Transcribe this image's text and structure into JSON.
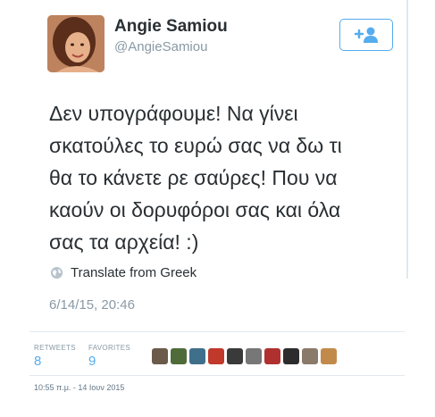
{
  "user": {
    "name": "Angie Samiou",
    "handle": "@AngieSamiou"
  },
  "tweet": {
    "lines": [
      "Δεν υπογράφουμε! Να γίνει",
      "σκατούλες το ευρώ σας να δω τι",
      "θα το κάνετε ρε σαύρες! Που να",
      "καούν οι δορυφόροι σας και όλα",
      "σας τα αρχεία! :)"
    ],
    "translate_label": "Translate from Greek",
    "date": "6/14/15, 20:46"
  },
  "stats": {
    "retweets_label": "RETWEETS",
    "retweets_value": "8",
    "favorites_label": "FAVORITES",
    "favorites_value": "9"
  },
  "favoriters": [
    {
      "color": "#6b5a4a"
    },
    {
      "color": "#4f6b3a"
    },
    {
      "color": "#3f6f8a"
    },
    {
      "color": "#c0392b"
    },
    {
      "color": "#3a3a3a"
    },
    {
      "color": "#777777"
    },
    {
      "color": "#b03030"
    },
    {
      "color": "#2c2c2c"
    },
    {
      "color": "#8a7a6a"
    },
    {
      "color": "#c28a4a"
    }
  ],
  "footer": {
    "timestamp": "10:55 π.μ. - 14 Ιουν 2015"
  },
  "colors": {
    "accent": "#55acee",
    "muted": "#8899a6",
    "text": "#292f33"
  }
}
